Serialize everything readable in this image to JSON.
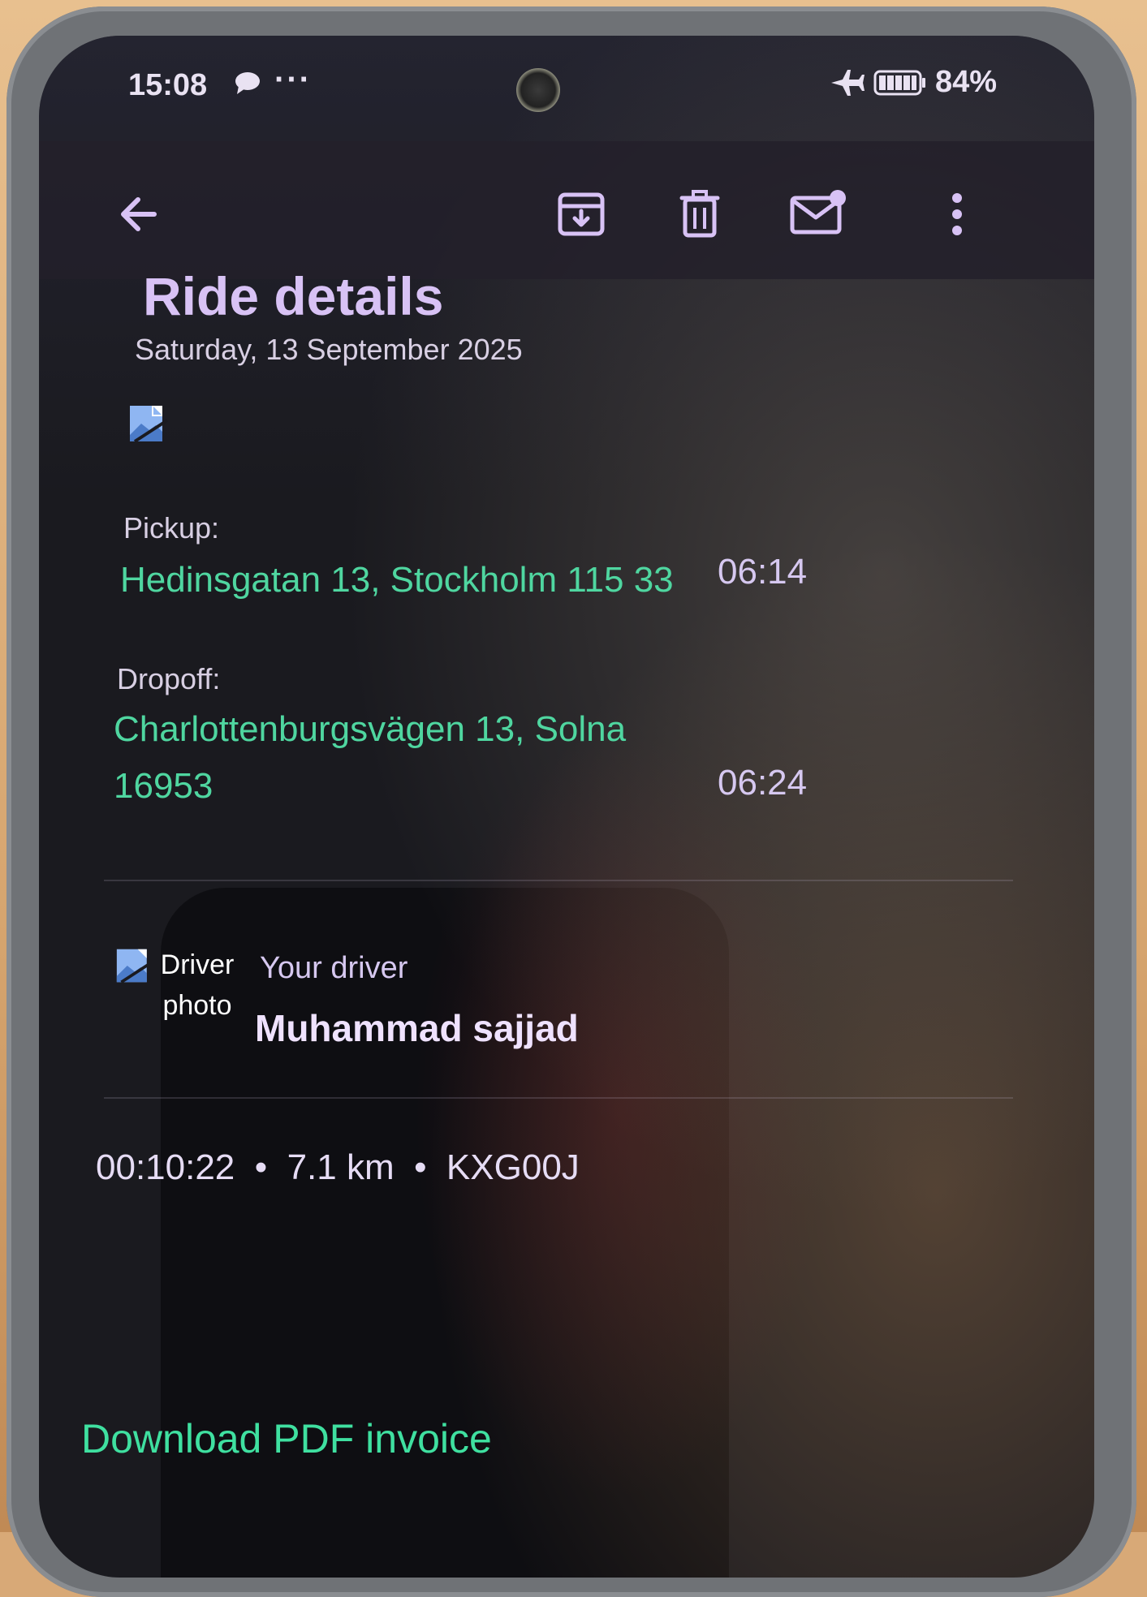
{
  "status_bar": {
    "time": "15:08",
    "overflow": "···",
    "battery_percent": "84%",
    "icons": [
      "chat-bubble-icon",
      "airplane-mode-icon",
      "battery-icon"
    ]
  },
  "toolbar": {
    "icons": [
      "back-arrow-icon",
      "archive-icon",
      "delete-icon",
      "mark-unread-icon",
      "more-vert-icon"
    ]
  },
  "email": {
    "title": "Ride details",
    "date": "Saturday, 13 September 2025",
    "pickup": {
      "label": "Pickup:",
      "address": "Hedinsgatan 13, Stockholm 115 33",
      "time": "06:14"
    },
    "dropoff": {
      "label": "Dropoff:",
      "address": "Charlottenburgsvägen 13, Solna 16953",
      "time": "06:24"
    },
    "driver": {
      "photo_alt": "Driver photo",
      "label": "Your driver",
      "name": "Muhammad sajjad"
    },
    "trip_info": "00:10:22  •  7.1 km  •  KXG00J",
    "invoice_link": "Download PDF invoice"
  },
  "colors": {
    "accent_purple": "#d8c2f5",
    "link_green": "#4fd6a0",
    "background": "#1a1a1f"
  }
}
